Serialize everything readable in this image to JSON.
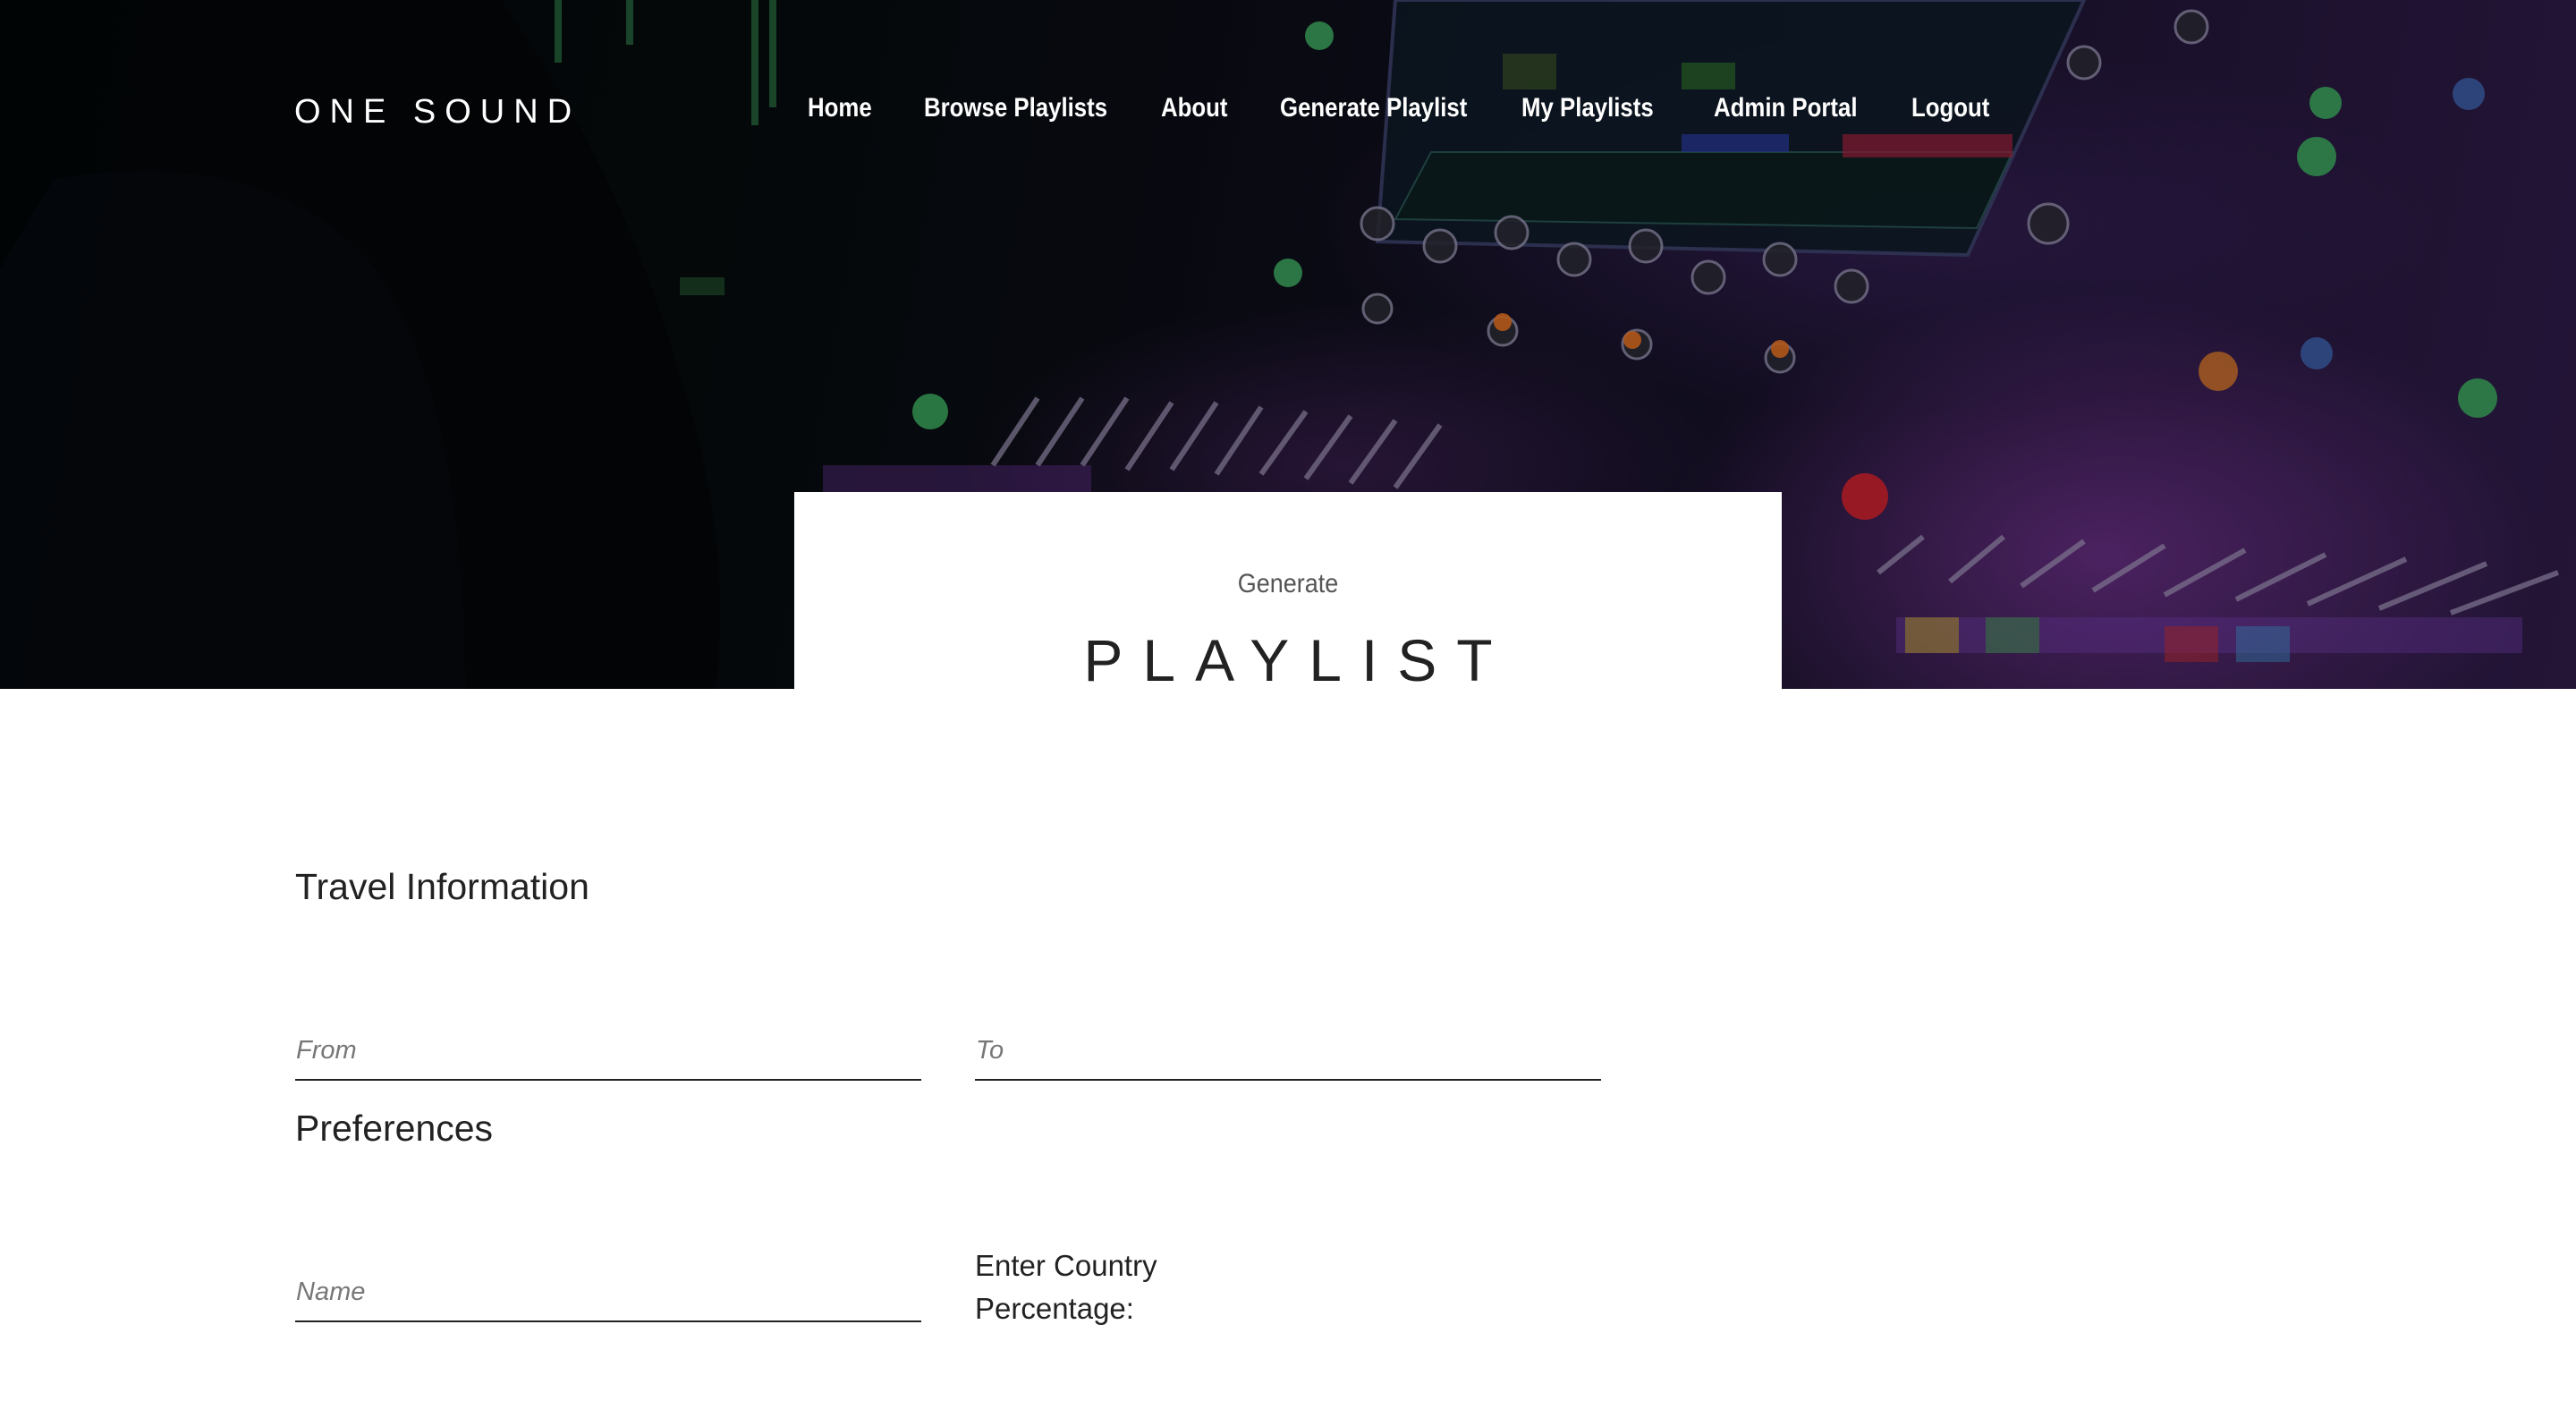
{
  "brand": {
    "name": "ONE SOUND"
  },
  "nav": {
    "items": [
      {
        "label": "Home"
      },
      {
        "label": "Browse Playlists"
      },
      {
        "label": "About"
      },
      {
        "label": "Generate Playlist"
      },
      {
        "label": "My Playlists"
      },
      {
        "label": "Admin Portal"
      },
      {
        "label": "Logout"
      }
    ]
  },
  "hero": {
    "subtitle": "Generate",
    "title": "PLAYLIST"
  },
  "travel": {
    "heading": "Travel Information",
    "from_placeholder": "From",
    "to_placeholder": "To"
  },
  "preferences": {
    "heading": "Preferences",
    "name_placeholder": "Name",
    "country_percentage_label": "Enter Country Percentage:"
  }
}
